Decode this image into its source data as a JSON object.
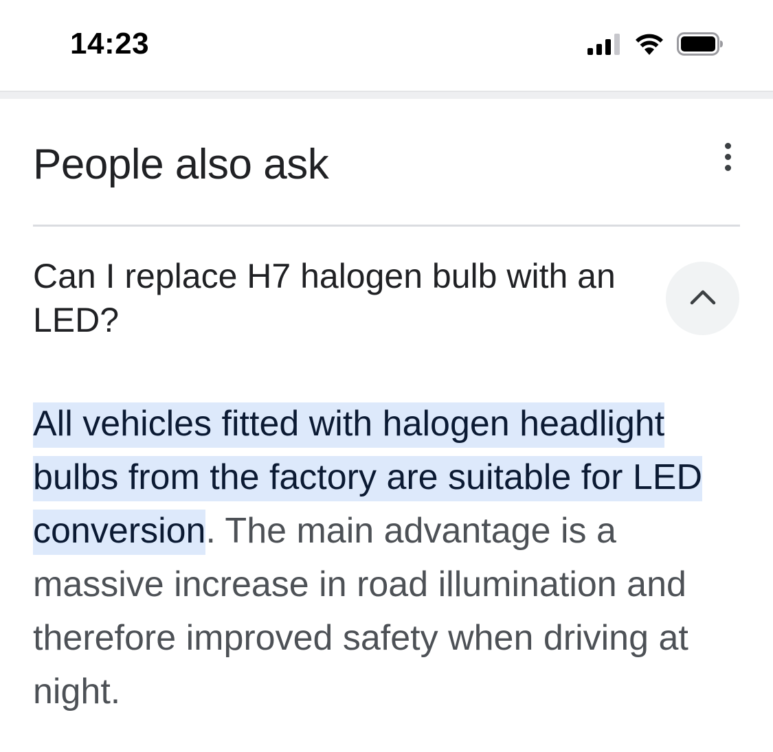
{
  "status_bar": {
    "time": "14:23",
    "icons": [
      "cellular-signal-icon",
      "wifi-icon",
      "battery-icon"
    ]
  },
  "section": {
    "title": "People also ask",
    "more_icon": "more-vert-icon"
  },
  "question": {
    "text": "Can I replace H7 halogen bulb with an LED?",
    "expanded": true,
    "toggle_icon": "chevron-up-icon"
  },
  "answer": {
    "highlighted_text": "All vehicles fitted with halogen headlight bulbs from the factory are suitable for LED conversion",
    "rest_text": ". The main advantage is a massive increase in road illumination and therefore improved safety when driving at night."
  },
  "colors": {
    "highlight_background": "#dde9fb",
    "highlight_text": "#0b1a33",
    "body_text": "#4d5156",
    "title_text": "#202124",
    "divider": "#dadce0",
    "chevron_button_bg": "#f1f3f4"
  }
}
